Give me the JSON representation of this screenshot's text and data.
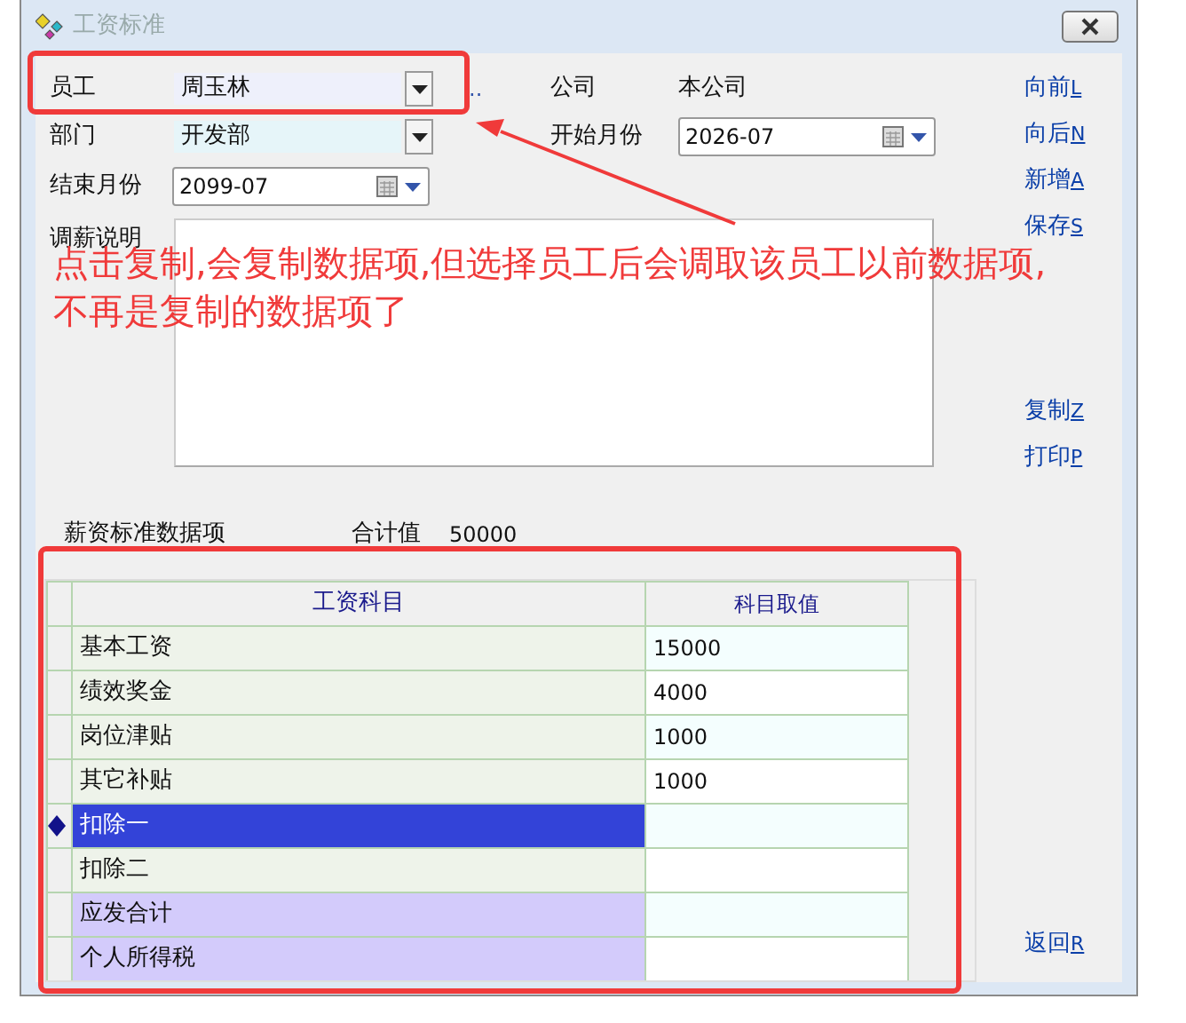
{
  "window": {
    "title": "工资标准"
  },
  "form": {
    "employee": {
      "label": "员工",
      "value": "周玉林"
    },
    "picker_dots": "..",
    "company": {
      "label": "公司",
      "value": "本公司"
    },
    "department": {
      "label": "部门",
      "value": "开发部"
    },
    "start_month": {
      "label": "开始月份",
      "value": "2026-07"
    },
    "end_month": {
      "label": "结束月份",
      "value": "2099-07"
    },
    "note": {
      "label": "调薪说明"
    }
  },
  "action_groups": [
    [
      {
        "label": "向前",
        "key": "L"
      },
      {
        "label": "向后",
        "key": "N"
      },
      {
        "label": "新增",
        "key": "A"
      },
      {
        "label": "保存",
        "key": "S"
      }
    ],
    [
      {
        "label": "复制",
        "key": "Z"
      },
      {
        "label": "打印",
        "key": "P"
      }
    ],
    [
      {
        "label": "返回",
        "key": "R"
      }
    ]
  ],
  "grid": {
    "section_label": "薪资标准数据项",
    "total_label": "合计值",
    "total": "50000",
    "columns": [
      "工资科目",
      "科目取值"
    ],
    "rows": [
      {
        "item": "基本工资",
        "value": "15000",
        "kind": "input",
        "selected": false
      },
      {
        "item": "绩效奖金",
        "value": "4000",
        "kind": "input",
        "selected": false
      },
      {
        "item": "岗位津贴",
        "value": "1000",
        "kind": "input",
        "selected": false
      },
      {
        "item": "其它补贴",
        "value": "1000",
        "kind": "input",
        "selected": false
      },
      {
        "item": "扣除一",
        "kind": "input",
        "selected": true
      },
      {
        "item": "扣除二",
        "kind": "input",
        "selected": false
      },
      {
        "item": "应发合计",
        "kind": "summary",
        "selected": false
      },
      {
        "item": "个人所得税",
        "kind": "summary",
        "selected": false
      }
    ]
  },
  "annotation": {
    "lines": [
      "点击复制,会复制数据项,但选择员工后会调取该员工以前数据项,",
      "不再是复制的数据项了"
    ]
  }
}
